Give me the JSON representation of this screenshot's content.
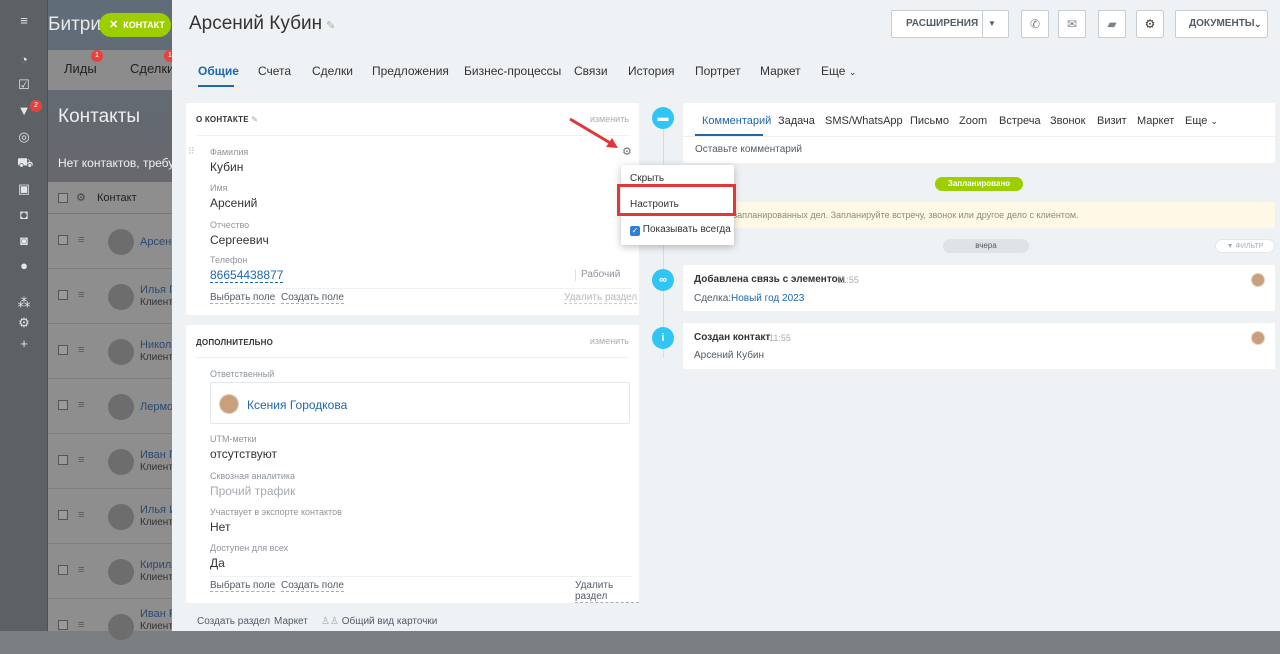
{
  "background_app": {
    "title": "Битри",
    "chip_label": "КОНТАКТ",
    "tabs": [
      {
        "label": "Лиды",
        "badge": "1"
      },
      {
        "label": "Сделки",
        "badge": "1"
      }
    ],
    "nav_badge": "2",
    "heading": "Контакты",
    "note": "Нет контактов, требую",
    "column_header": "Контакт",
    "rows": [
      {
        "name": "Арсени",
        "sub": ""
      },
      {
        "name": "Илья П",
        "sub": "Клиент"
      },
      {
        "name": "Никола",
        "sub": "Клиент"
      },
      {
        "name": "Лермон",
        "sub": ""
      },
      {
        "name": "Иван Г",
        "sub": "Клиент"
      },
      {
        "name": "Илья И",
        "sub": "Клиент"
      },
      {
        "name": "Кирилл",
        "sub": "Клиент"
      },
      {
        "name": "Иван Р",
        "sub": "Клиент"
      }
    ]
  },
  "header": {
    "title": "Арсений Кубин",
    "extensions_label": "РАСШИРЕНИЯ",
    "documents_label": "ДОКУМЕНТЫ"
  },
  "tabs": [
    "Общие",
    "Счета",
    "Сделки",
    "Предложения",
    "Бизнес-процессы",
    "Связи",
    "История",
    "Портрет",
    "Маркет",
    "Еще"
  ],
  "about": {
    "title": "О КОНТАКТЕ",
    "edit": "изменить",
    "fields": [
      {
        "label": "Фамилия",
        "value": "Кубин"
      },
      {
        "label": "Имя",
        "value": "Арсений"
      },
      {
        "label": "Отчество",
        "value": "Сергеевич"
      },
      {
        "label": "Телефон",
        "value": "86654438877",
        "type": "Рабочий"
      }
    ],
    "select_field": "Выбрать поле",
    "create_field": "Создать поле",
    "delete_section": "Удалить раздел"
  },
  "additional": {
    "title": "ДОПОЛНИТЕЛЬНО",
    "edit": "изменить",
    "responsible_label": "Ответственный",
    "responsible_name": "Ксения Городкова",
    "fields": [
      {
        "label": "UTM-метки",
        "value": "отсутствуют"
      },
      {
        "label": "Сквозная аналитика",
        "value": "Прочий трафик"
      },
      {
        "label": "Участвует в экспорте контактов",
        "value": "Нет"
      },
      {
        "label": "Доступен для всех",
        "value": "Да"
      }
    ],
    "select_field": "Выбрать поле",
    "create_field": "Создать поле",
    "delete_section": "Удалить раздел"
  },
  "footer": {
    "create_section": "Создать раздел",
    "market": "Маркет",
    "common_view": "Общий вид карточки"
  },
  "menu": {
    "hide": "Скрыть",
    "configure": "Настроить",
    "show_always": "Показывать всегда",
    "show_always_checked": true
  },
  "timeline": {
    "tabs": [
      "Комментарий",
      "Задача",
      "SMS/WhatsApp",
      "Письмо",
      "Zoom",
      "Встреча",
      "Звонок",
      "Визит",
      "Маркет",
      "Еще"
    ],
    "comment_placeholder": "Оставьте комментарий",
    "planned_label": "Запланировано",
    "planned_note": "запланированных дел. Запланируйте встречу, звонок или другое дело с клиентом.",
    "yesterday_label": "вчера",
    "filter_label": "ФИЛЬТР",
    "events": [
      {
        "title": "Добавлена связь с элементом",
        "time": "11:55",
        "detail_label": "Сделка:",
        "detail_link": "Новый год 2023"
      },
      {
        "title": "Создан контакт",
        "time": "11:55",
        "detail_text": "Арсений Кубин"
      }
    ]
  },
  "colors": {
    "accent": "#2067b0",
    "green": "#9dcf00",
    "timeline_blue": "#2fc6f6",
    "highlight_red": "#e0373b"
  }
}
